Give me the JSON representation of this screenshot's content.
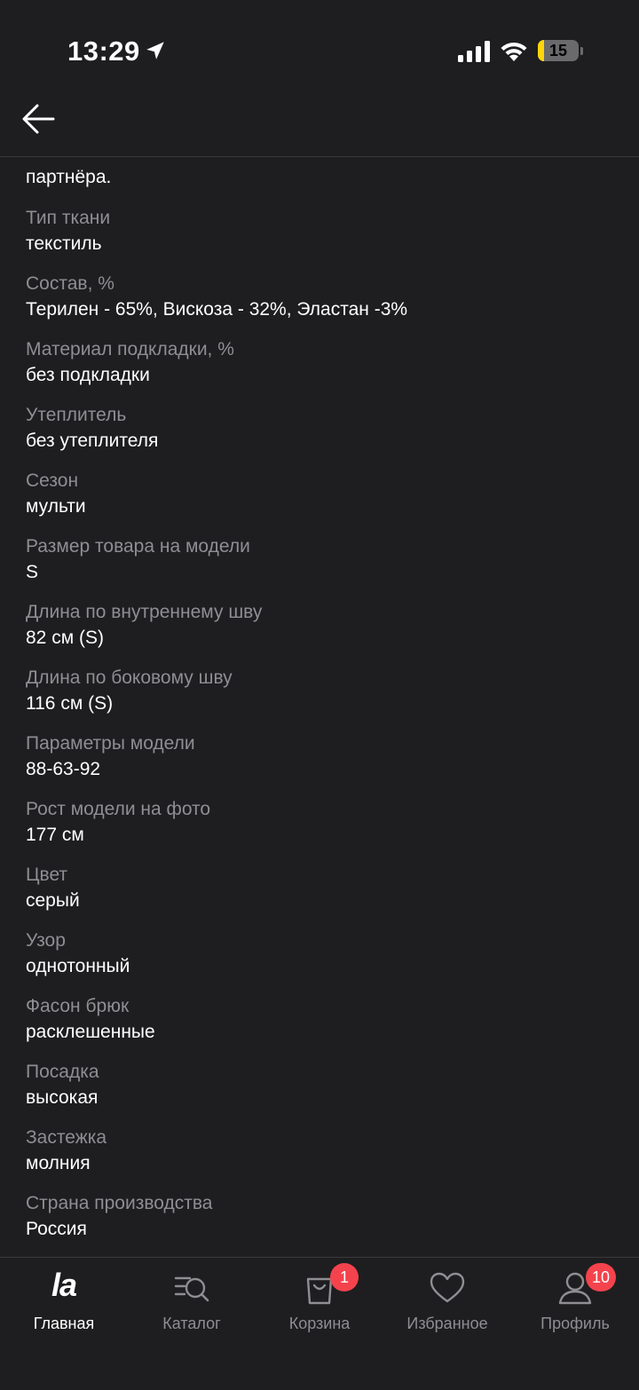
{
  "status_bar": {
    "time": "13:29",
    "battery_level": "15",
    "battery_fraction": 0.15,
    "battery_color": "#ffd60a",
    "icons": [
      "location-arrow-icon",
      "signal-icon",
      "wifi-icon",
      "battery-icon"
    ]
  },
  "header": {
    "back_icon": "arrow-left-icon"
  },
  "content": {
    "intro_text": "партнёра.",
    "properties": [
      {
        "label": "Тип ткани",
        "value": "текстиль"
      },
      {
        "label": "Состав, %",
        "value": "Терилен - 65%, Вискоза - 32%, Эластан -3%"
      },
      {
        "label": "Материал подкладки, %",
        "value": "без подкладки"
      },
      {
        "label": "Утеплитель",
        "value": "без утеплителя"
      },
      {
        "label": "Сезон",
        "value": "мульти"
      },
      {
        "label": "Размер товара на модели",
        "value": "S"
      },
      {
        "label": "Длина по внутреннему шву",
        "value": "82 см (S)"
      },
      {
        "label": "Длина по боковому шву",
        "value": "116 см (S)"
      },
      {
        "label": "Параметры модели",
        "value": "88-63-92"
      },
      {
        "label": "Рост модели на фото",
        "value": "177 см"
      },
      {
        "label": "Цвет",
        "value": "серый"
      },
      {
        "label": "Узор",
        "value": "однотонный"
      },
      {
        "label": "Фасон брюк",
        "value": "расклешенные"
      },
      {
        "label": "Посадка",
        "value": "высокая"
      },
      {
        "label": "Застежка",
        "value": "молния"
      },
      {
        "label": "Страна производства",
        "value": "Россия"
      }
    ]
  },
  "tab_bar": {
    "tabs": [
      {
        "label": "Главная",
        "icon": "la-logo-icon",
        "logo_text": "la",
        "active": true
      },
      {
        "label": "Каталог",
        "icon": "catalog-search-icon"
      },
      {
        "label": "Корзина",
        "icon": "shopping-bag-icon",
        "badge": "1"
      },
      {
        "label": "Избранное",
        "icon": "heart-icon"
      },
      {
        "label": "Профиль",
        "icon": "profile-icon",
        "badge": "10"
      }
    ],
    "badge_color": "#f4434d"
  }
}
